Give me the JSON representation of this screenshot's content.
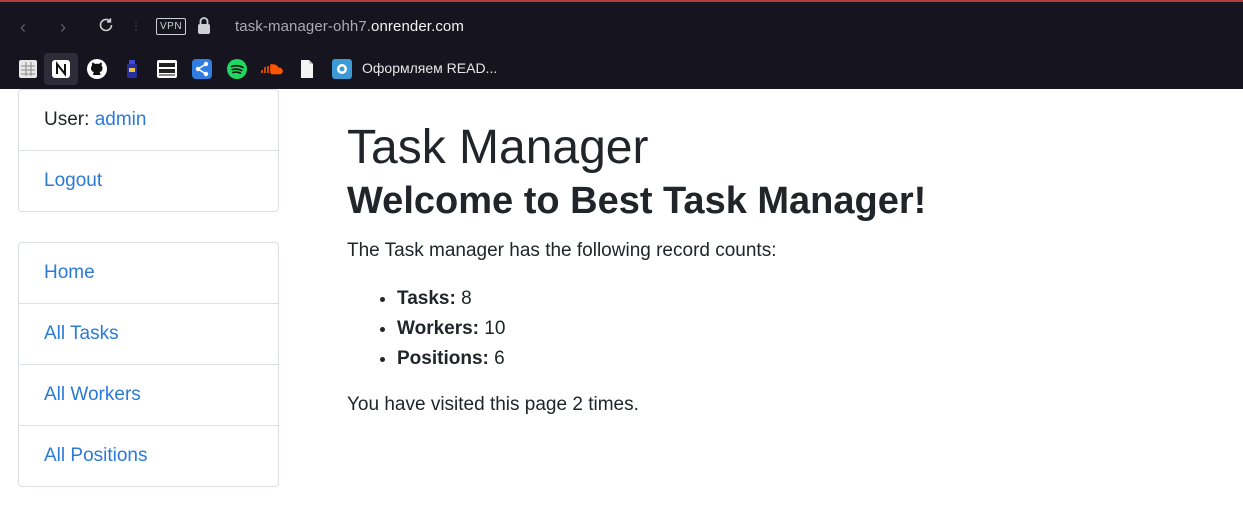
{
  "browser": {
    "vpn_label": "VPN",
    "url_path": "task-manager-ohh7.",
    "url_host": "onrender.com",
    "bookmarks": [
      {
        "icon": "sheets-icon"
      },
      {
        "icon": "notion-icon"
      },
      {
        "icon": "github-icon"
      },
      {
        "icon": "bottle-icon"
      },
      {
        "icon": "schedule-icon"
      },
      {
        "icon": "share-icon"
      },
      {
        "icon": "spotify-icon"
      },
      {
        "icon": "soundcloud-icon"
      },
      {
        "icon": "document-icon"
      },
      {
        "icon": "readme-icon"
      }
    ],
    "bookmark_label": "Оформляем READ..."
  },
  "user_box": {
    "user_prefix": "User: ",
    "username": "admin",
    "logout": "Logout"
  },
  "nav": {
    "items": [
      {
        "label": "Home"
      },
      {
        "label": "All Tasks"
      },
      {
        "label": "All Workers"
      },
      {
        "label": "All Positions"
      }
    ]
  },
  "main": {
    "title": "Task Manager",
    "subtitle": "Welcome to Best Task Manager!",
    "intro": "The Task manager has the following record counts:",
    "counts": [
      {
        "label": "Tasks:",
        "value": "8"
      },
      {
        "label": "Workers:",
        "value": "10"
      },
      {
        "label": "Positions:",
        "value": "6"
      }
    ],
    "visits": "You have visited this page 2 times."
  },
  "colors": {
    "link": "#2a7ad6",
    "chrome_bg": "#16151f",
    "text": "#212529"
  }
}
